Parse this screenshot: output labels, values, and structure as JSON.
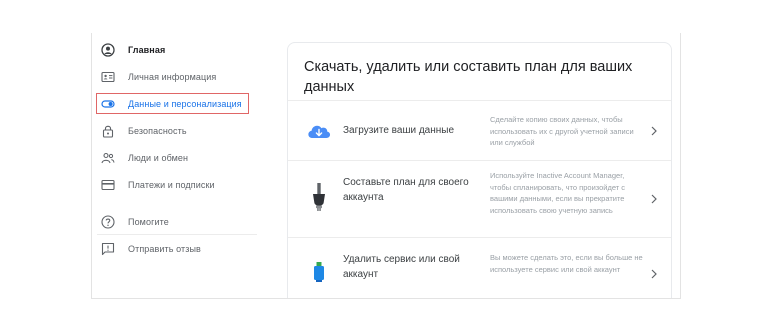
{
  "sidebar": {
    "items": [
      {
        "label": "Главная",
        "icon": "account-circle-icon"
      },
      {
        "label": "Личная информация",
        "icon": "id-card-icon"
      },
      {
        "label": "Данные и персонализация",
        "icon": "toggle-icon"
      },
      {
        "label": "Безопасность",
        "icon": "lock-icon"
      },
      {
        "label": "Люди и обмен",
        "icon": "people-icon"
      },
      {
        "label": "Платежи и подписки",
        "icon": "credit-card-icon"
      },
      {
        "label": "Помогите",
        "icon": "help-icon"
      },
      {
        "label": "Отправить отзыв",
        "icon": "feedback-icon"
      }
    ]
  },
  "card": {
    "title": "Скачать, удалить или составить план для ваших данных",
    "rows": [
      {
        "title": "Загрузите ваши данные",
        "description": "Сделайте копию своих данных, чтобы использовать их с другой учетной записи или службой",
        "icon": "cloud-download-icon"
      },
      {
        "title": "Составьте план для своего аккаунта",
        "description": "Используйте Inactive Account Manager, чтобы спланировать, что произойдет с вашими данными, если вы прекратите использовать свою учетную запись",
        "icon": "plug-icon"
      },
      {
        "title": "Удалить сервис или свой аккаунт",
        "description": "Вы можете сделать это, если вы больше не используете сервис или свой аккаунт",
        "icon": "trash-can-icon"
      }
    ]
  },
  "colors": {
    "accent": "#1a73e8",
    "highlight_border": "#e06666",
    "muted_text": "#9aa0a6"
  }
}
